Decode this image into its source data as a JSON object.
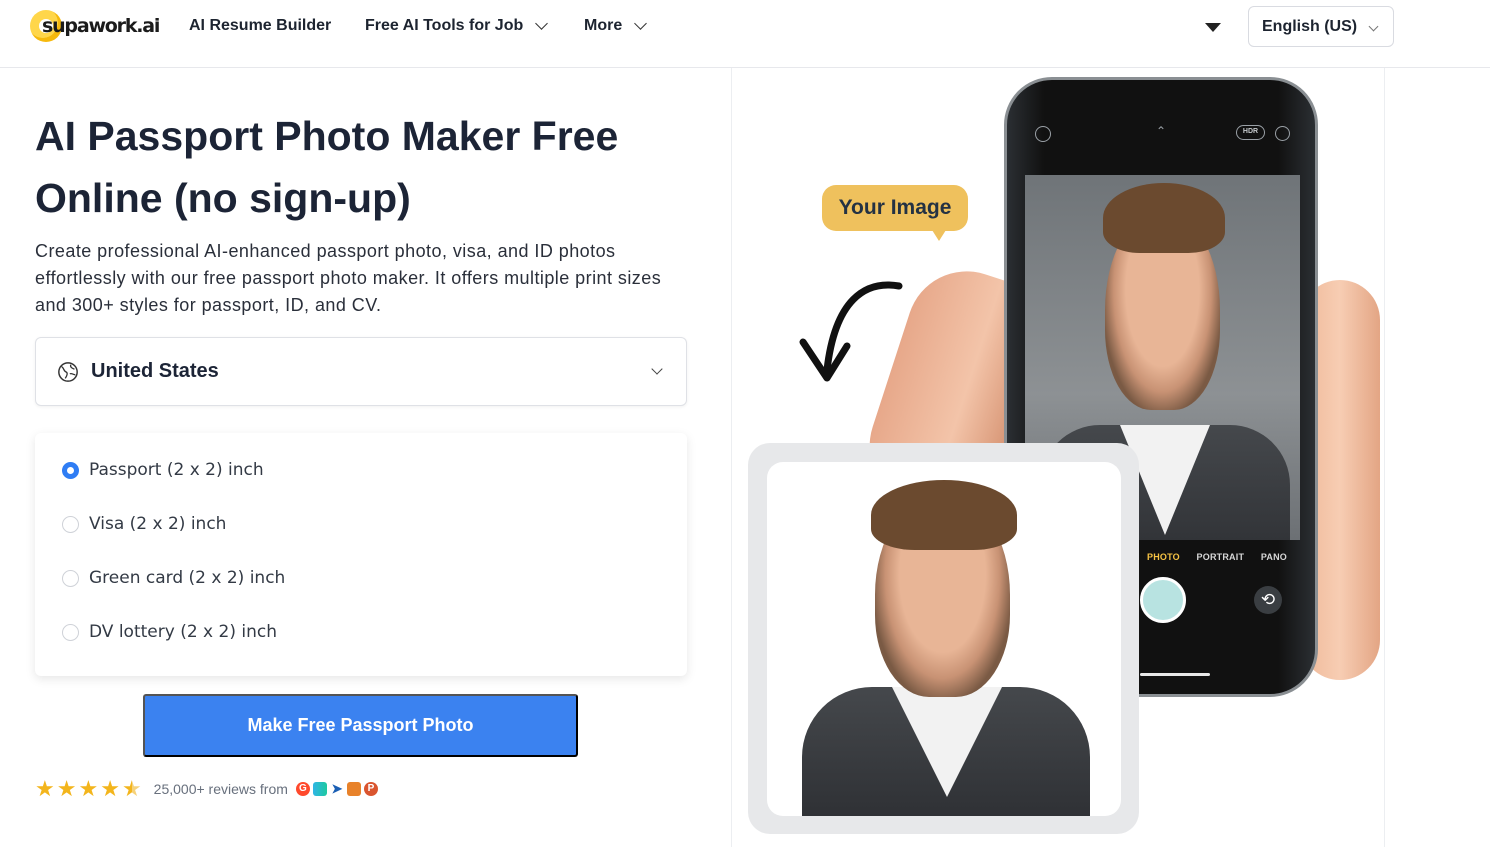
{
  "nav": {
    "logo_text": "supawork.ai",
    "links": [
      {
        "label": "AI Resume Builder",
        "has_dropdown": false
      },
      {
        "label": "Free AI Tools for Job",
        "has_dropdown": true
      },
      {
        "label": "More",
        "has_dropdown": true
      }
    ],
    "language": "English (US)"
  },
  "hero": {
    "title": "AI Passport Photo Maker Free Online (no sign-up)",
    "subtitle": "Create professional AI-enhanced passport photo, visa, and ID photos effortlessly with our free passport photo maker. It offers multiple print sizes and 300+ styles for passport, ID, and CV."
  },
  "country_select": {
    "icon": "globe-icon",
    "value": "United States"
  },
  "photo_types": [
    {
      "label": "Passport (2 x 2) inch",
      "selected": true
    },
    {
      "label": "Visa (2 x 2) inch",
      "selected": false
    },
    {
      "label": "Green card (2 x 2) inch",
      "selected": false
    },
    {
      "label": "DV lottery (2 x 2) inch",
      "selected": false
    }
  ],
  "cta": {
    "label": "Make Free Passport Photo"
  },
  "reviews": {
    "rating": 4.5,
    "text": "25,000+ reviews from",
    "sources": [
      "g2-icon",
      "capterra-icon",
      "trustpilot-icon",
      "chat-review-icon",
      "producthunt-icon"
    ]
  },
  "illustration": {
    "bubble": "Your Image",
    "camera_modes": [
      "PHOTO",
      "PORTRAIT",
      "PANO"
    ],
    "active_mode": "PHOTO",
    "top_icons": [
      "HDR"
    ]
  },
  "colors": {
    "accent": "#3b82f0",
    "bubble": "#efc15d",
    "star": "#f3b51c"
  }
}
